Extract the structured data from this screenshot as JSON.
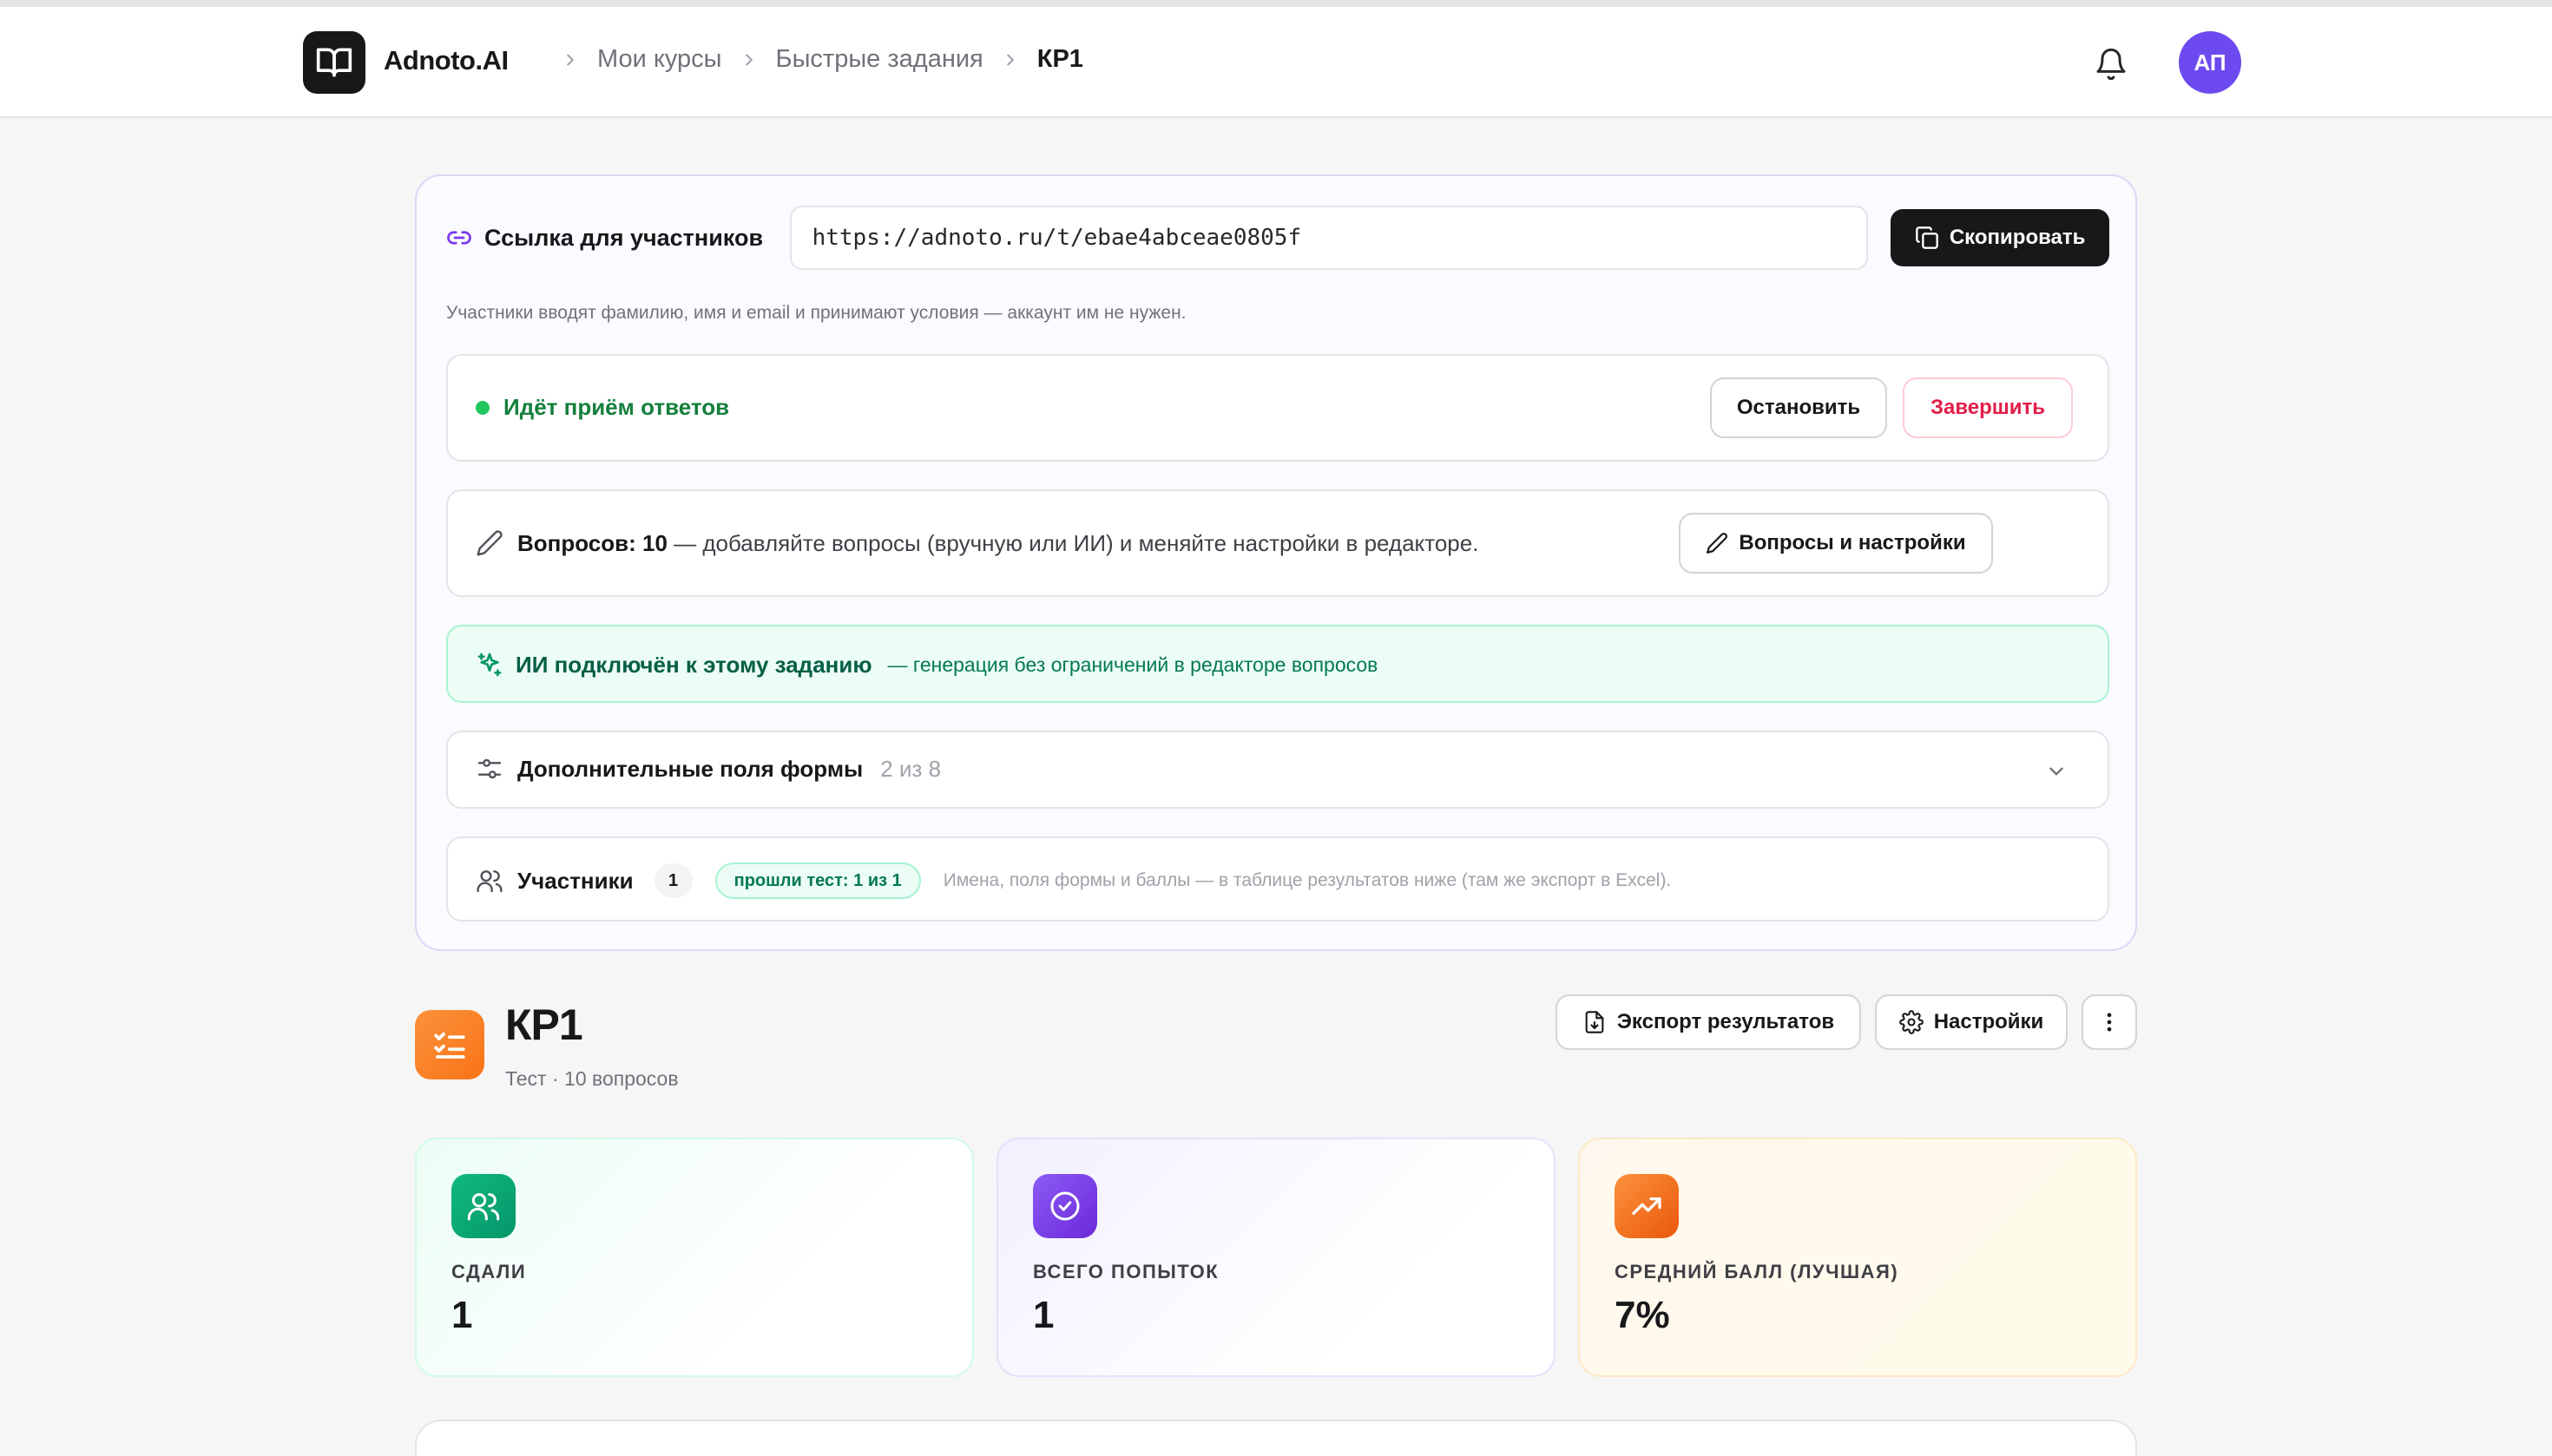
{
  "header": {
    "brand": "Adnoto.AI",
    "breadcrumbs": [
      "Мои курсы",
      "Быстрые задания",
      "КР1"
    ],
    "avatar_initials": "АП"
  },
  "link_panel": {
    "label": "Ссылка для участников",
    "url": "https://adnoto.ru/t/ebae4abceae0805f",
    "copy_label": "Скопировать",
    "hint": "Участники вводят фамилию, имя и email и принимают условия — аккаунт им не нужен."
  },
  "status": {
    "text": "Идёт приём ответов",
    "stop_label": "Остановить",
    "finish_label": "Завершить"
  },
  "questions": {
    "count_label": "Вопросов: 10",
    "description": "— добавляйте вопросы (вручную или ИИ) и меняйте настройки в редакторе.",
    "button_label": "Вопросы и настройки"
  },
  "ai": {
    "title": "ИИ подключён к этому заданию",
    "note": "— генерация без ограничений в редакторе вопросов"
  },
  "extra_fields": {
    "title": "Дополнительные поля формы",
    "count": "2 из 8"
  },
  "participants": {
    "title": "Участники",
    "count": "1",
    "passed": "прошли тест: 1 из 1",
    "note": "Имена, поля формы и баллы — в таблице результатов ниже (там же экспорт в Excel)."
  },
  "test": {
    "title": "КР1",
    "subtitle": "Тест · 10 вопросов",
    "export_label": "Экспорт результатов",
    "settings_label": "Настройки"
  },
  "stats": [
    {
      "label": "СДАЛИ",
      "value": "1",
      "icon": "users-icon"
    },
    {
      "label": "ВСЕГО ПОПЫТОК",
      "value": "1",
      "icon": "check-circle-icon"
    },
    {
      "label": "СРЕДНИЙ БАЛЛ (ЛУЧШАЯ)",
      "value": "7%",
      "icon": "trending-up-icon"
    }
  ],
  "colors": {
    "accent": "#6d4aef",
    "success": "#22c55e",
    "danger": "#e11d48",
    "orange": "#f97316"
  }
}
